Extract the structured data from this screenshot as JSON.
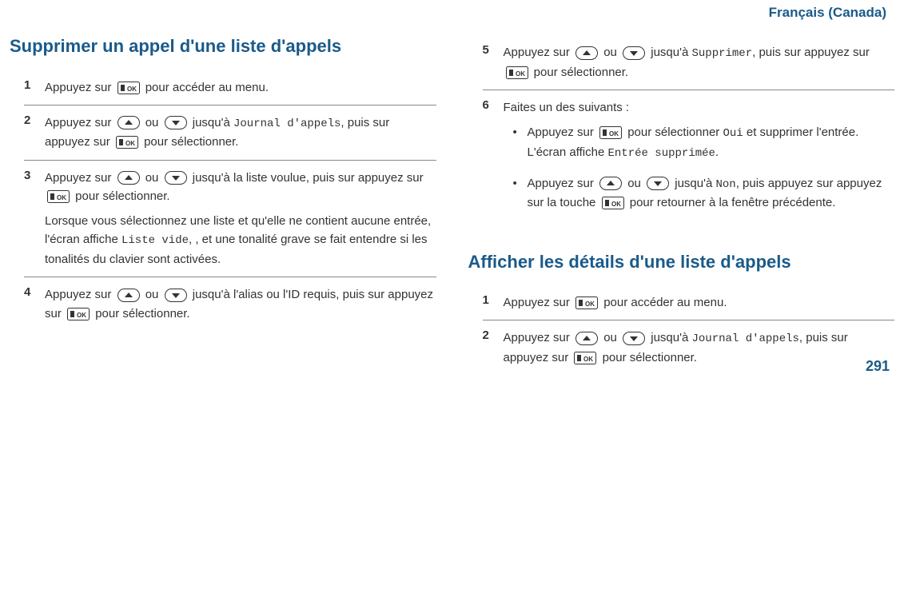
{
  "header": {
    "language": "Français (Canada)"
  },
  "page_number": "291",
  "text": {
    "press": "Appuyez sur ",
    "or": " ou ",
    "until": " jusqu'à ",
    "then_press": ", puis sur appuyez sur ",
    "to_select": " pour sélectionner.",
    "to_menu": " pour accéder au menu."
  },
  "mono": {
    "journal": "Journal d'appels",
    "supprimer": "Supprimer",
    "oui": "Oui",
    "entree_supprimee": "Entrée supprimée",
    "non": "Non",
    "liste_vide": "Liste vide"
  },
  "sections": {
    "delete": {
      "title": "Supprimer un appel d'une liste d'appels",
      "step3_until": " jusqu'à la liste voulue, puis sur appuyez sur ",
      "step3_note_a": "Lorsque vous sélectionnez une liste et qu'elle ne contient aucune entrée, l'écran affiche ",
      "step3_note_b": ", , et une tonalité grave se fait entendre si les tonalités du clavier sont activées.",
      "step4_until": " jusqu'à l'alias ou l'ID requis, puis sur appuyez sur ",
      "step6_intro": "Faites un des suivants :",
      "step6_b1_a": " pour sélectionner ",
      "step6_b1_b": " et supprimer l'entrée. L'écran affiche ",
      "step6_b1_c": ".",
      "step6_b2_a": ", puis appuyez sur appuyez sur la touche ",
      "step6_b2_b": " pour retourner à la fenêtre précédente."
    },
    "details": {
      "title": "Afficher les détails d'une liste d'appels"
    }
  },
  "icons": {
    "ok": "ok-button",
    "up": "up-button",
    "down": "down-button"
  }
}
